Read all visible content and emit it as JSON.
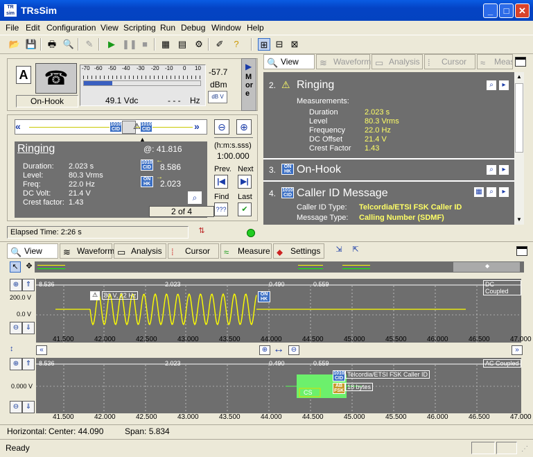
{
  "window": {
    "title": "TRsSim"
  },
  "menu": [
    "File",
    "Edit",
    "Configuration",
    "View",
    "Scripting",
    "Run",
    "Debug",
    "Window",
    "Help"
  ],
  "line_panel": {
    "line_letter": "A",
    "hook_state": "On-Hook",
    "meter_scale": [
      "-70",
      "-60",
      "-50",
      "-40",
      "-30",
      "-20",
      "-10",
      "0",
      "10"
    ],
    "level_value": "-57.7",
    "level_unit": "dBm",
    "unit_toggle": "dB V",
    "dc_value": "49.1 Vdc",
    "freq_value": "- - -",
    "freq_unit": "Hz",
    "more_label": "More"
  },
  "event_panel": {
    "title": "Ringing",
    "at_label": "@: 41.816",
    "marker1": "8.586",
    "marker2": "2.023",
    "fields": [
      {
        "label": "Duration:",
        "value": "2.023  s"
      },
      {
        "label": "Level:",
        "value": "80.3  Vrms"
      },
      {
        "label": "Freq:",
        "value": "22.0  Hz"
      },
      {
        "label": "DC Volt:",
        "value": "21.4  V"
      },
      {
        "label": "Crest factor:",
        "value": "1.43"
      }
    ],
    "counter": "2 of 4",
    "time_format": "(h:m:s.sss)",
    "time_value": "1:00.000",
    "prev_label": "Prev.",
    "next_label": "Next",
    "find_label": "Find",
    "last_label": "Last",
    "elapsed": "Elapsed Time:  2:26 s"
  },
  "right_tabs": [
    "View",
    "Waveform",
    "Analysis",
    "Cursor",
    "Meas"
  ],
  "events": [
    {
      "num": "2.",
      "title": "Ringing",
      "sub": "Measurements:",
      "rows": [
        {
          "k": "Duration",
          "v": "2.023  s"
        },
        {
          "k": "Level",
          "v": "80.3  Vrms"
        },
        {
          "k": "Frequency",
          "v": "22.0  Hz"
        },
        {
          "k": "DC Offset",
          "v": "21.4  V"
        },
        {
          "k": "Crest Factor",
          "v": "1.43"
        }
      ]
    },
    {
      "num": "3.",
      "title": "On-Hook"
    },
    {
      "num": "4.",
      "title": "Caller ID Message",
      "rows": [
        {
          "k": "Caller ID Type:",
          "v": "Telcordia/ETSI FSK Caller ID"
        },
        {
          "k": "Message Type:",
          "v": "Calling Number (SDMF)"
        }
      ]
    }
  ],
  "bottom_tabs": [
    "View",
    "Waveform",
    "Analysis",
    "Cursor",
    "Measure",
    "Settings"
  ],
  "waveform": {
    "top_coupling": "DC Coupled",
    "bottom_coupling": "AC Coupled",
    "top_y": [
      "200.0 V",
      "0.0 V"
    ],
    "bottom_y": [
      "0.000 V"
    ],
    "segments": [
      "8.536",
      "2.023",
      "0.490",
      "0.559"
    ],
    "ring_label": "80 V, 22 Hz",
    "cid_label": "Telcordia/ETSI FSK Caller ID",
    "bytes_label": "18 bytes",
    "cs_label": "CS",
    "x_ticks": [
      "41.500",
      "42.000",
      "42.500",
      "43.000",
      "43.500",
      "44.000",
      "44.500",
      "45.000",
      "45.500",
      "46.000",
      "46.500",
      "47.000"
    ]
  },
  "horizontal": {
    "label": "Horizontal:",
    "center": "Center: 44.090",
    "span": "Span: 5.834"
  },
  "status": "Ready"
}
